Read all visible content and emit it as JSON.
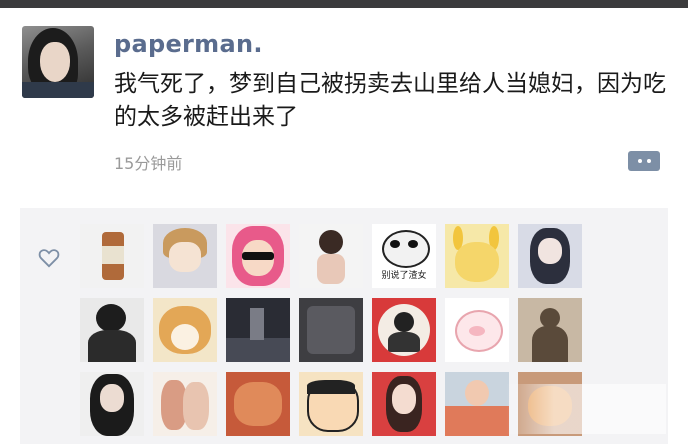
{
  "post": {
    "username": "paperman.",
    "text": "我气死了，梦到自己被拐卖去山里给人当媳妇，因为吃的太多被赶出来了",
    "timestamp": "15分钟前"
  },
  "icons": {
    "comment": "comment-dots-icon",
    "like": "heart-outline-icon"
  },
  "likes": {
    "avatar_count": 21,
    "avatars": [
      {
        "name": "bottle-avatar",
        "sticker_text": ""
      },
      {
        "name": "anime-girl-avatar",
        "sticker_text": ""
      },
      {
        "name": "pink-hair-sunglasses-avatar",
        "sticker_text": ""
      },
      {
        "name": "sketch-girl-avatar",
        "sticker_text": ""
      },
      {
        "name": "panda-meme-avatar",
        "sticker_text": "别说了渣女"
      },
      {
        "name": "yellow-bunny-avatar",
        "sticker_text": ""
      },
      {
        "name": "dark-anime-girl-avatar",
        "sticker_text": ""
      },
      {
        "name": "guy-avatar",
        "sticker_text": ""
      },
      {
        "name": "shiba-dog-avatar",
        "sticker_text": ""
      },
      {
        "name": "night-city-avatar",
        "sticker_text": ""
      },
      {
        "name": "dark-room-avatar",
        "sticker_text": ""
      },
      {
        "name": "red-frame-avatar",
        "sticker_text": ""
      },
      {
        "name": "pig-avatar",
        "sticker_text": ""
      },
      {
        "name": "shadow-avatar",
        "sticker_text": ""
      },
      {
        "name": "long-hair-girl-avatar",
        "sticker_text": ""
      },
      {
        "name": "sketch-couple-avatar",
        "sticker_text": ""
      },
      {
        "name": "food-avatar",
        "sticker_text": ""
      },
      {
        "name": "cartoon-boy-avatar",
        "sticker_text": ""
      },
      {
        "name": "red-background-girl-avatar",
        "sticker_text": ""
      },
      {
        "name": "beach-avatar",
        "sticker_text": ""
      },
      {
        "name": "cat-avatar",
        "sticker_text": ""
      }
    ]
  },
  "colors": {
    "username": "#5a6c8e",
    "panel": "#f3f3f5",
    "comment_button": "#7d8fa6",
    "timestamp": "#9a9a9a"
  }
}
